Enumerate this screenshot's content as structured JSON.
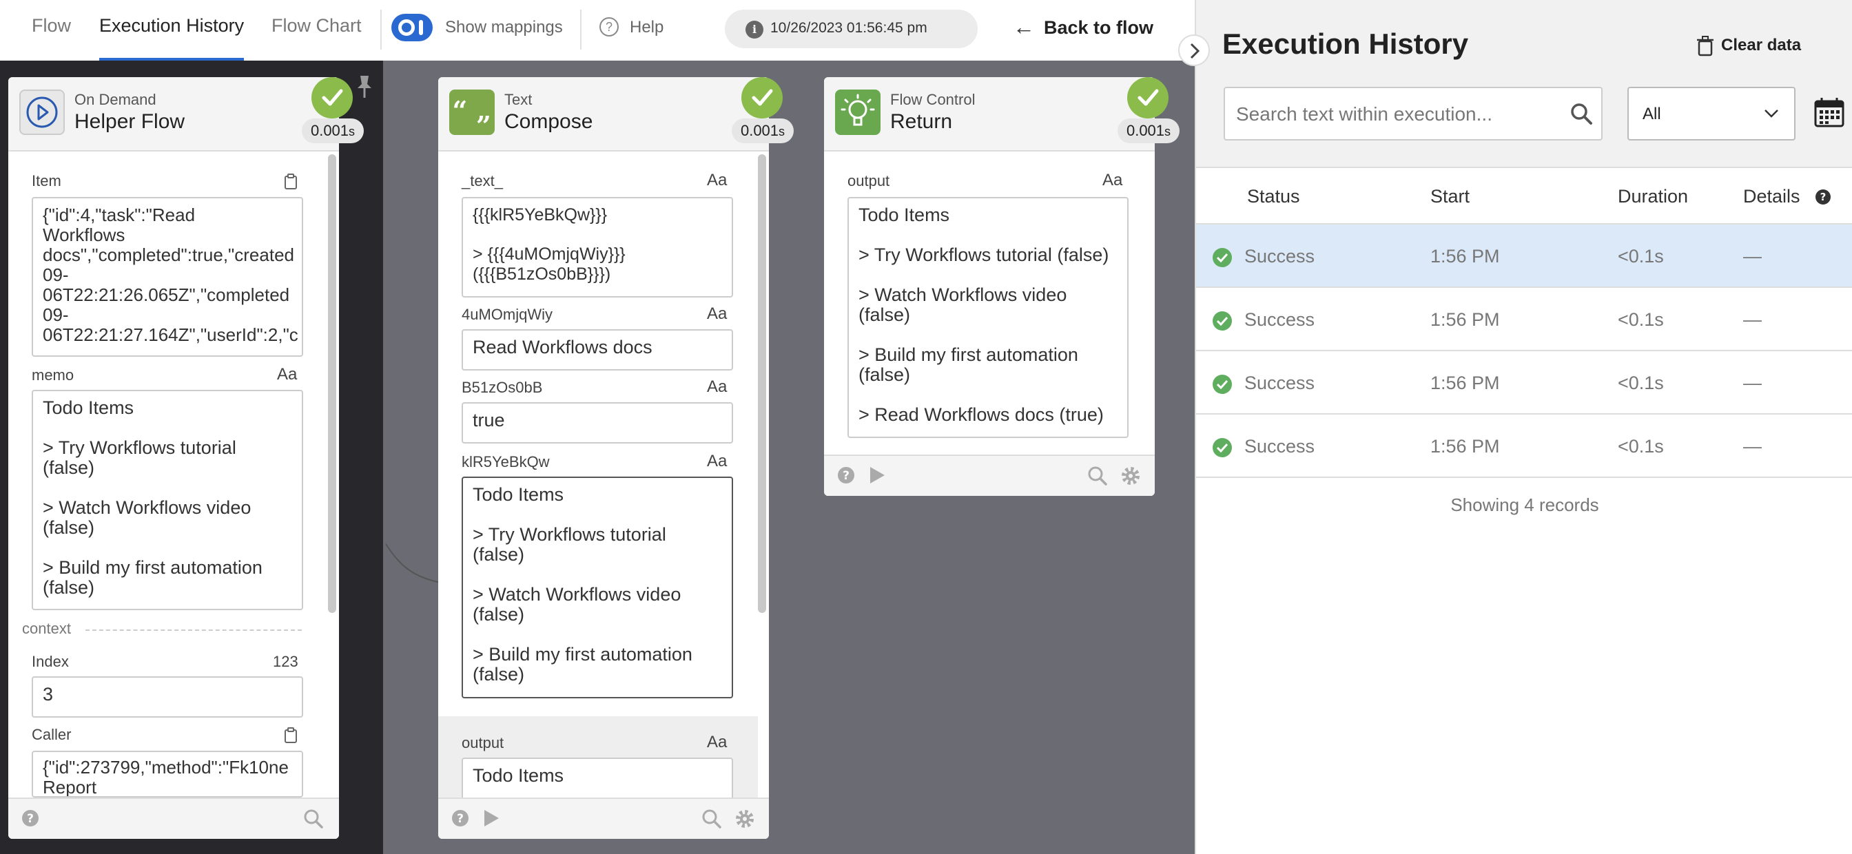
{
  "nav": {
    "tabs": [
      {
        "label": "Flow"
      },
      {
        "label": "Execution History"
      },
      {
        "label": "Flow Chart"
      }
    ],
    "show_mappings_label": "Show mappings",
    "help_label": "Help",
    "timestamp": "10/26/2023 01:56:45 pm",
    "back_label": "Back to flow"
  },
  "nodes": {
    "helper": {
      "subtitle": "On Demand",
      "title": "Helper Flow",
      "time": "0.001",
      "time_unit": "s",
      "item_label": "Item",
      "item_value_lines": [
        "{\"id\":4,\"task\":\"Read",
        "Workflows",
        "docs\",\"completed\":true,\"created",
        "09-",
        "06T22:21:26.065Z\",\"completed",
        "09-",
        "06T22:21:27.164Z\",\"userId\":2,\"c"
      ],
      "memo_label": "memo",
      "memo_type": "Aa",
      "memo_lines": [
        "Todo Items",
        "> Try Workflows tutorial (false)",
        "> Watch Workflows video (false)",
        "> Build my first automation (false)"
      ],
      "context_label": "context",
      "index_label": "Index",
      "index_type": "123",
      "index_value": "3",
      "caller_label": "Caller",
      "caller_value_lines": [
        "{\"id\":273799,\"method\":\"Fk10ne",
        "Report"
      ]
    },
    "compose": {
      "subtitle": "Text",
      "title": "Compose",
      "time": "0.001",
      "time_unit": "s",
      "text_label": "_text_",
      "text_type": "Aa",
      "text_lines": [
        "{{{klR5YeBkQw}}}",
        "> {{{4uMOmjqWiy}}} ({{{B51zOs0bB}}})"
      ],
      "f1_label": "4uMOmjqWiy",
      "f1_type": "Aa",
      "f1_value": "Read Workflows docs",
      "f2_label": "B51zOs0bB",
      "f2_type": "Aa",
      "f2_value": "true",
      "f3_label": "klR5YeBkQw",
      "f3_type": "Aa",
      "f3_lines": [
        "Todo Items",
        "> Try Workflows tutorial (false)",
        "> Watch Workflows video (false)",
        "> Build my first automation (false)"
      ],
      "output_label": "output",
      "output_type": "Aa",
      "output_value": "Todo Items"
    },
    "ret": {
      "subtitle": "Flow Control",
      "title": "Return",
      "time": "0.001",
      "time_unit": "s",
      "output_label": "output",
      "output_type": "Aa",
      "output_lines": [
        "Todo Items",
        "> Try Workflows tutorial (false)",
        "> Watch Workflows video (false)",
        "> Build my first automation (false)",
        "> Read Workflows docs (true)"
      ]
    }
  },
  "panel": {
    "title": "Execution History",
    "clear_label": "Clear data",
    "search_placeholder": "Search text within execution...",
    "filter_value": "All",
    "columns": {
      "status": "Status",
      "start": "Start",
      "duration": "Duration",
      "details": "Details"
    },
    "rows": [
      {
        "status": "Success",
        "start": "1:56 PM",
        "duration": "<0.1s",
        "details": "—"
      },
      {
        "status": "Success",
        "start": "1:56 PM",
        "duration": "<0.1s",
        "details": "—"
      },
      {
        "status": "Success",
        "start": "1:56 PM",
        "duration": "<0.1s",
        "details": "—"
      },
      {
        "status": "Success",
        "start": "1:56 PM",
        "duration": "<0.1s",
        "details": "—"
      }
    ],
    "records_label": "Showing 4 records"
  },
  "colors": {
    "accent": "#2a6ad0",
    "success": "#8bbb4a",
    "selected_row": "#dbe9f9"
  }
}
